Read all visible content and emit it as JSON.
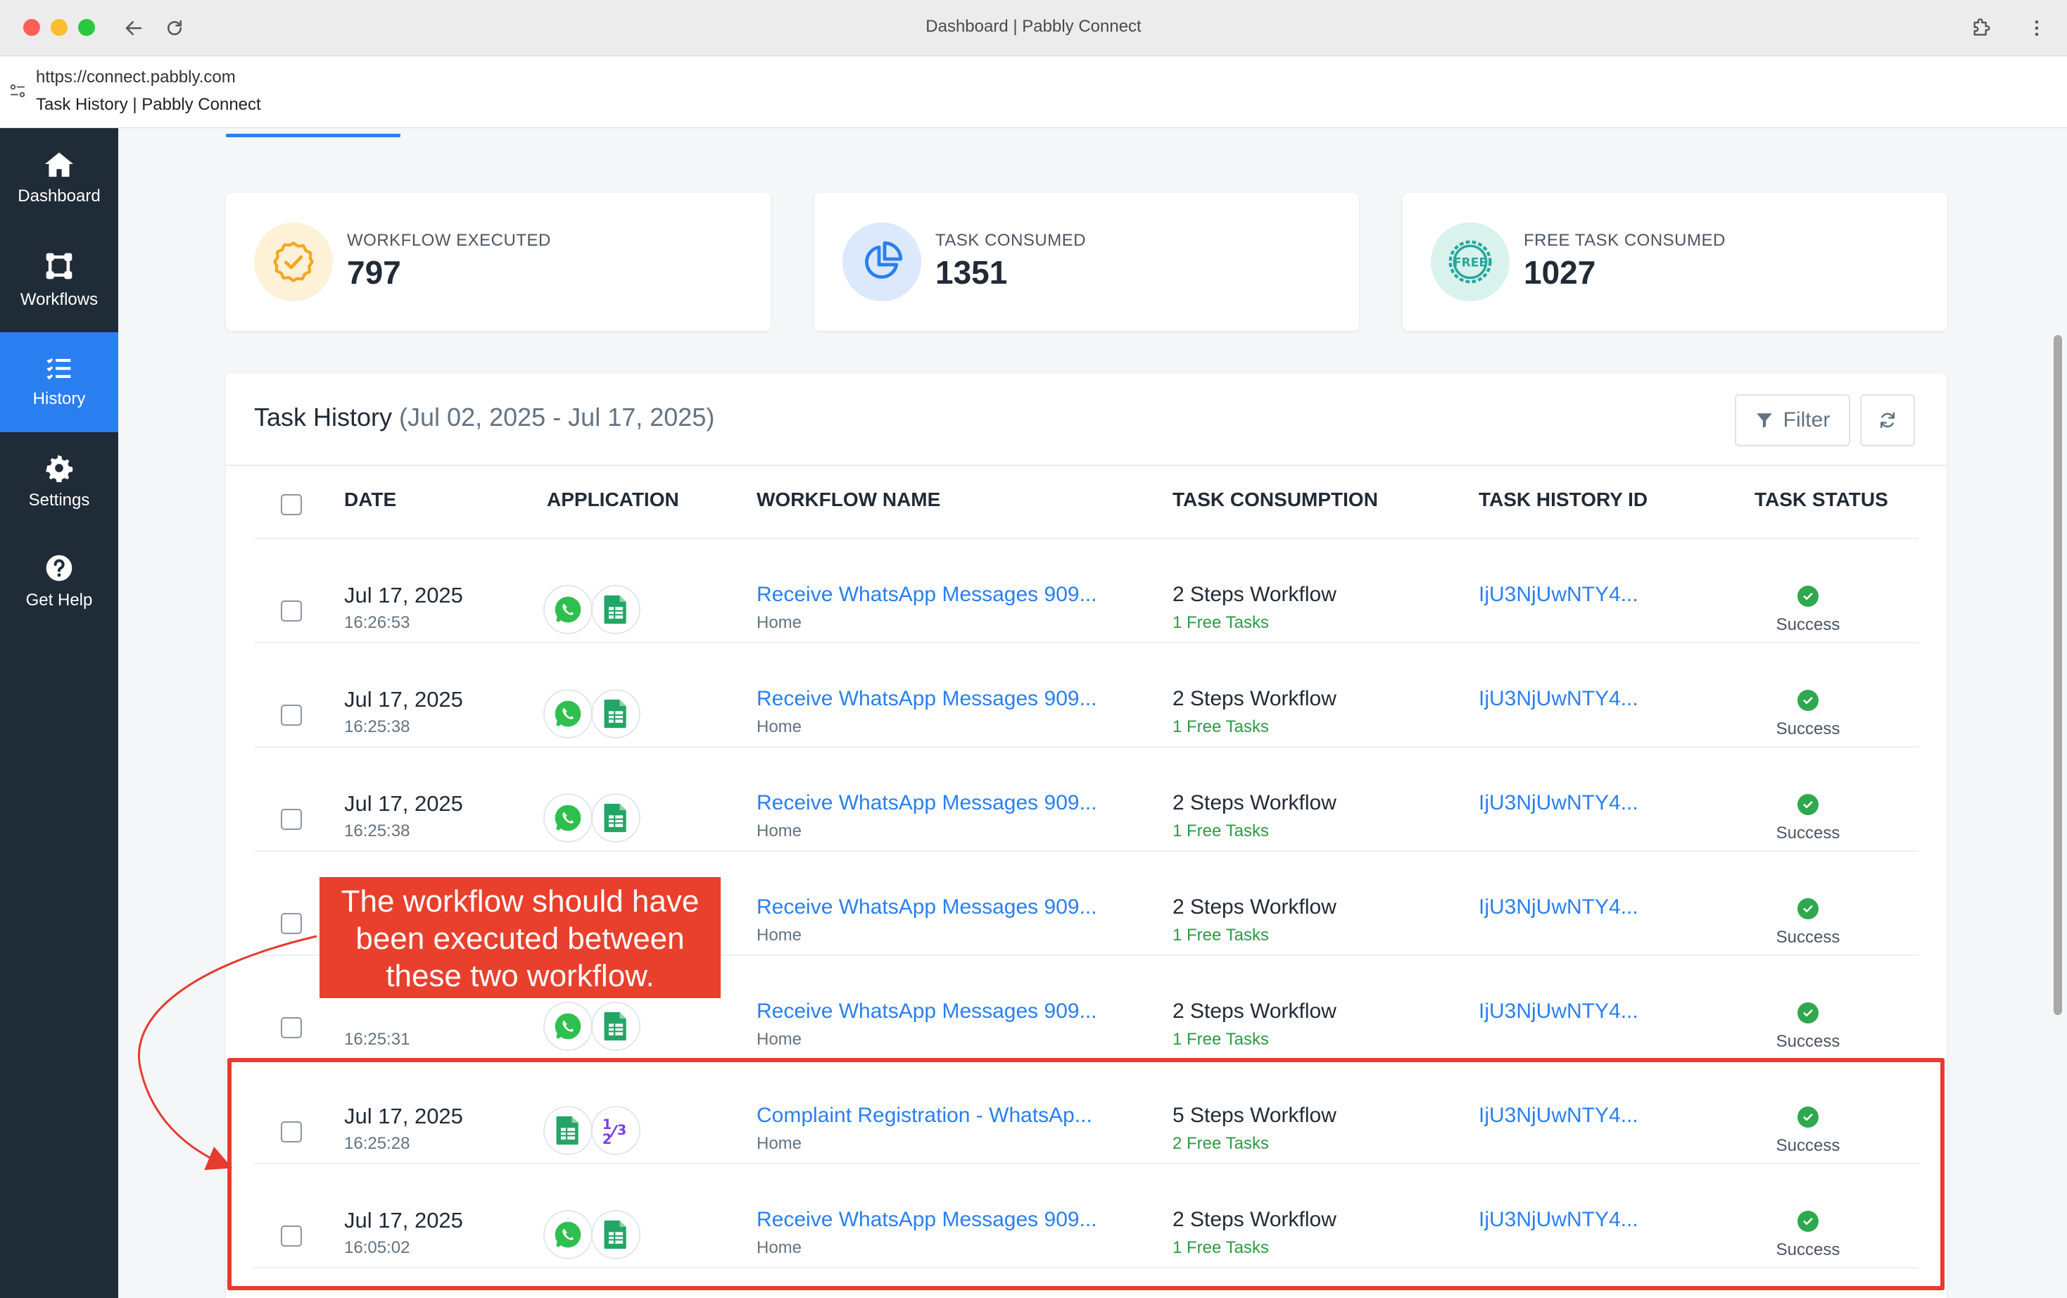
{
  "browser": {
    "window_title": "Dashboard | Pabbly Connect",
    "url": "https://connect.pabbly.com",
    "page_title": "Task History | Pabbly Connect"
  },
  "sidebar": {
    "items": [
      {
        "label": "Dashboard",
        "icon": "home-icon"
      },
      {
        "label": "Workflows",
        "icon": "workflow-icon"
      },
      {
        "label": "History",
        "icon": "list-icon",
        "active": true
      },
      {
        "label": "Settings",
        "icon": "gear-icon"
      },
      {
        "label": "Get Help",
        "icon": "help-icon"
      }
    ]
  },
  "stats": [
    {
      "label": "WORKFLOW EXECUTED",
      "value": "797",
      "icon": "badge-check-icon",
      "color": "#f5a623"
    },
    {
      "label": "TASK CONSUMED",
      "value": "1351",
      "icon": "pie-chart-icon",
      "color": "#2a7ff0"
    },
    {
      "label": "FREE TASK CONSUMED",
      "value": "1027",
      "icon": "free-icon",
      "color": "#26a69a"
    }
  ],
  "task_history": {
    "title": "Task History",
    "range": "(Jul 02, 2025 - Jul 17, 2025)",
    "filter_label": "Filter",
    "columns": [
      "DATE",
      "APPLICATION",
      "WORKFLOW NAME",
      "TASK CONSUMPTION",
      "TASK HISTORY ID",
      "TASK STATUS"
    ],
    "rows": [
      {
        "date": "Jul 17, 2025",
        "time": "16:26:53",
        "apps": [
          "whatsapp-icon",
          "google-sheets-icon"
        ],
        "workflow": "Receive WhatsApp Messages 909...",
        "folder": "Home",
        "steps": "2 Steps Workflow",
        "free": "1 Free Tasks",
        "id": "IjU3NjUwNTY4...",
        "status": "Success"
      },
      {
        "date": "Jul 17, 2025",
        "time": "16:25:38",
        "apps": [
          "whatsapp-icon",
          "google-sheets-icon"
        ],
        "workflow": "Receive WhatsApp Messages 909...",
        "folder": "Home",
        "steps": "2 Steps Workflow",
        "free": "1 Free Tasks",
        "id": "IjU3NjUwNTY4...",
        "status": "Success"
      },
      {
        "date": "Jul 17, 2025",
        "time": "16:25:38",
        "apps": [
          "whatsapp-icon",
          "google-sheets-icon"
        ],
        "workflow": "Receive WhatsApp Messages 909...",
        "folder": "Home",
        "steps": "2 Steps Workflow",
        "free": "1 Free Tasks",
        "id": "IjU3NjUwNTY4...",
        "status": "Success"
      },
      {
        "date": "",
        "time": "",
        "apps": [],
        "workflow": "Receive WhatsApp Messages 909...",
        "folder": "Home",
        "steps": "2 Steps Workflow",
        "free": "1 Free Tasks",
        "id": "IjU3NjUwNTY4...",
        "status": "Success"
      },
      {
        "date": "",
        "time": "16:25:31",
        "apps": [
          "whatsapp-icon",
          "google-sheets-icon"
        ],
        "workflow": "Receive WhatsApp Messages 909...",
        "folder": "Home",
        "steps": "2 Steps Workflow",
        "free": "1 Free Tasks",
        "id": "IjU3NjUwNTY4...",
        "status": "Success"
      },
      {
        "date": "Jul 17, 2025",
        "time": "16:25:28",
        "apps": [
          "google-sheets-icon",
          "number-formatter-icon"
        ],
        "workflow": "Complaint Registration - WhatsAp...",
        "folder": "Home",
        "steps": "5 Steps Workflow",
        "free": "2 Free Tasks",
        "id": "IjU3NjUwNTY4...",
        "status": "Success"
      },
      {
        "date": "Jul 17, 2025",
        "time": "16:05:02",
        "apps": [
          "whatsapp-icon",
          "google-sheets-icon"
        ],
        "workflow": "Receive WhatsApp Messages 909...",
        "folder": "Home",
        "steps": "2 Steps Workflow",
        "free": "1 Free Tasks",
        "id": "IjU3NjUwNTY4...",
        "status": "Success"
      }
    ]
  },
  "annotation": {
    "callout_text": "The workflow should have been executed between these two workflow.",
    "color": "#e8402c"
  },
  "colors": {
    "sidebar_bg": "#202b38",
    "accent": "#2a7ff0",
    "success": "#2fa84f"
  }
}
